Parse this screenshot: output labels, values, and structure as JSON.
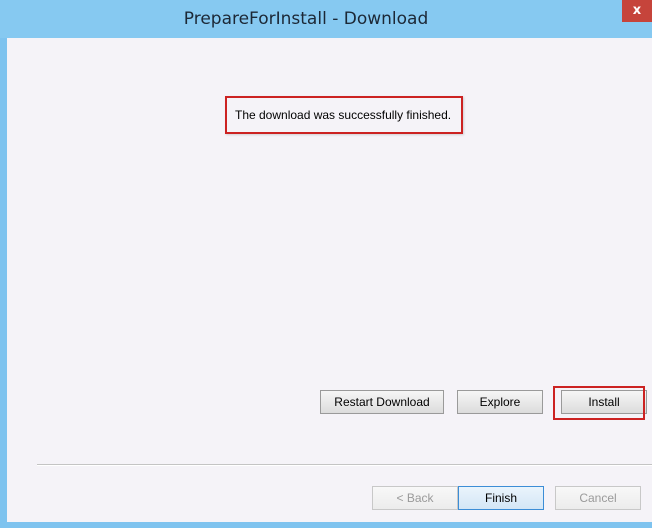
{
  "window": {
    "title": "PrepareForInstall - Download",
    "close_label": "x"
  },
  "content": {
    "message": "The download was successfully finished."
  },
  "actions": {
    "restart_download_label": "Restart Download",
    "explore_label": "Explore",
    "install_label": "Install"
  },
  "footer": {
    "back_label": "< Back",
    "finish_label": "Finish",
    "cancel_label": "Cancel"
  },
  "colors": {
    "titlebar": "#86c9f1",
    "close_button": "#c6443b",
    "annotation_border": "#cc2222"
  }
}
